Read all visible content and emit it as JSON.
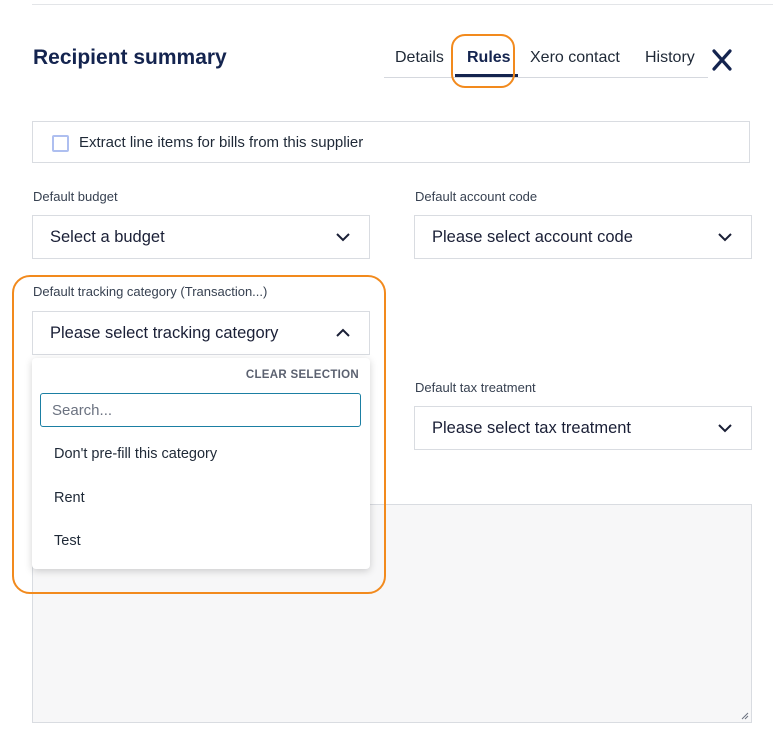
{
  "header": {
    "title": "Recipient summary",
    "tabs": [
      {
        "label": "Details",
        "active": false
      },
      {
        "label": "Rules",
        "active": true
      },
      {
        "label": "Xero contact",
        "active": false
      },
      {
        "label": "History",
        "active": false
      }
    ],
    "close_icon": "close-icon"
  },
  "extract_line_items": {
    "label": "Extract line items for bills from this supplier",
    "checked": false
  },
  "default_budget": {
    "label": "Default budget",
    "value": "Select a budget"
  },
  "default_account_code": {
    "label": "Default account code",
    "value": "Please select account code"
  },
  "default_tracking_category": {
    "label": "Default tracking category (Transaction...)",
    "value": "Please select tracking category",
    "expanded": true,
    "dropdown": {
      "clear_label": "CLEAR SELECTION",
      "search_placeholder": "Search...",
      "options": [
        "Don't pre-fill this category",
        "Rent",
        "Test"
      ]
    }
  },
  "default_tax_treatment": {
    "label": "Default tax treatment",
    "value": "Please select tax treatment"
  },
  "colors": {
    "title": "#14244f",
    "highlight": "#f28a1d",
    "search_focus": "#1b7fa3"
  }
}
